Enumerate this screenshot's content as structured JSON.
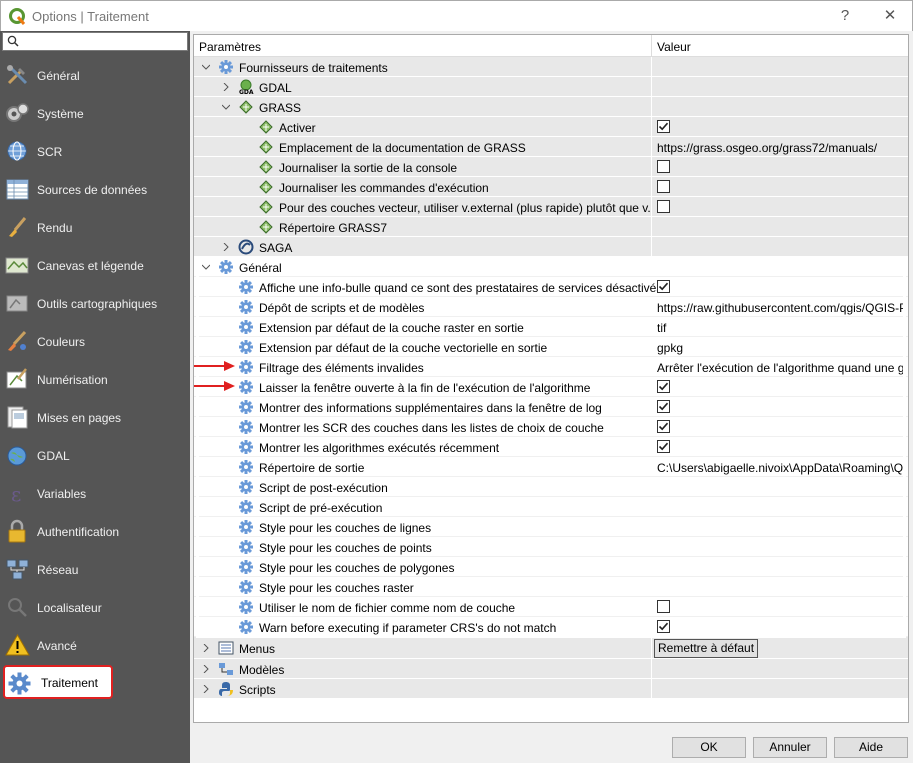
{
  "window": {
    "title": "Options | Traitement",
    "help": "?",
    "close": "✕"
  },
  "search": {
    "placeholder": ""
  },
  "sidebar": {
    "items": [
      {
        "label": "Général",
        "icon": "tools-icon"
      },
      {
        "label": "Système",
        "icon": "system-icon"
      },
      {
        "label": "SCR",
        "icon": "globe-icon"
      },
      {
        "label": "Sources de données",
        "icon": "table-icon"
      },
      {
        "label": "Rendu",
        "icon": "brush-icon"
      },
      {
        "label": "Canevas et légende",
        "icon": "map-icon"
      },
      {
        "label": "Outils cartographiques",
        "icon": "map-tools-icon"
      },
      {
        "label": "Couleurs",
        "icon": "paint-icon"
      },
      {
        "label": "Numérisation",
        "icon": "digitize-icon"
      },
      {
        "label": "Mises en pages",
        "icon": "layout-icon"
      },
      {
        "label": "GDAL",
        "icon": "gdal-globe-icon"
      },
      {
        "label": "Variables",
        "icon": "epsilon-icon"
      },
      {
        "label": "Authentification",
        "icon": "lock-icon"
      },
      {
        "label": "Réseau",
        "icon": "network-icon"
      },
      {
        "label": "Localisateur",
        "icon": "search-icon"
      },
      {
        "label": "Avancé",
        "icon": "warning-icon"
      },
      {
        "label": "Traitement",
        "icon": "gear-icon"
      }
    ]
  },
  "tree": {
    "col_params": "Paramètres",
    "col_value": "Valeur",
    "providers": {
      "label": "Fournisseurs de traitements",
      "gdal": "GDAL",
      "grass": {
        "label": "GRASS",
        "activate": "Activer",
        "doc_label": "Emplacement de la documentation de GRASS",
        "doc_value": "https://grass.osgeo.org/grass72/manuals/",
        "log_console": "Journaliser la sortie de la console",
        "log_commands": "Journaliser les commandes d'exécution",
        "vexternal": "Pour des couches vecteur, utiliser v.external (plus rapide) plutôt que v.in.ogr",
        "folder": "Répertoire GRASS7"
      },
      "saga": "SAGA"
    },
    "general": {
      "label": "Général",
      "tooltip": "Affiche une info-bulle quand ce sont des prestataires de services désactivés",
      "scripts_repo": "Dépôt de scripts et de modèles",
      "scripts_repo_value": "https://raw.githubusercontent.com/qgis/QGIS-Pr...",
      "raster_ext": "Extension par défaut de la couche raster en sortie",
      "raster_ext_value": "tif",
      "vector_ext": "Extension par défaut de la couche vectorielle en sortie",
      "vector_ext_value": "gpkg",
      "invalid_filter": "Filtrage des éléments invalides",
      "invalid_filter_value": "Arrêter l'exécution de l'algorithme quand une géo...",
      "keep_open": "Laisser la fenêtre ouverte à la fin de l'exécution de l'algorithme",
      "extra_info": "Montrer des informations supplémentaires dans la fenêtre de log",
      "show_crs": "Montrer les SCR des couches dans les listes de choix de couche",
      "recent_algs": "Montrer les algorithmes exécutés récemment",
      "output_folder": "Répertoire de sortie",
      "output_folder_value": "C:\\Users\\abigaelle.nivoix\\AppData\\Roaming\\QGI...",
      "post_script": "Script de post-exécution",
      "pre_script": "Script de pré-exécution",
      "style_lines": "Style pour les couches de lignes",
      "style_points": "Style pour les couches de points",
      "style_polygons": "Style pour les couches de polygones",
      "style_raster": "Style pour les couches raster",
      "filename_as_layer": "Utiliser le nom de fichier comme nom de couche",
      "warn_crs": "Warn before executing if parameter CRS's do not match"
    },
    "menus": "Menus",
    "reset": "Remettre à défaut",
    "models": "Modèles",
    "scripts": "Scripts"
  },
  "checks": {
    "activate": true,
    "log_console": false,
    "log_commands": false,
    "vexternal": false,
    "tooltip": true,
    "keep_open": true,
    "extra_info": true,
    "show_crs": true,
    "recent_algs": true,
    "filename_as_layer": false,
    "warn_crs": true
  },
  "footer": {
    "ok": "OK",
    "cancel": "Annuler",
    "help": "Aide"
  },
  "colors": {
    "sidebar_bg": "#555555",
    "highlight_border": "#e02020",
    "arrow_red": "#e02020",
    "row_bg": "#e8e8e8"
  }
}
